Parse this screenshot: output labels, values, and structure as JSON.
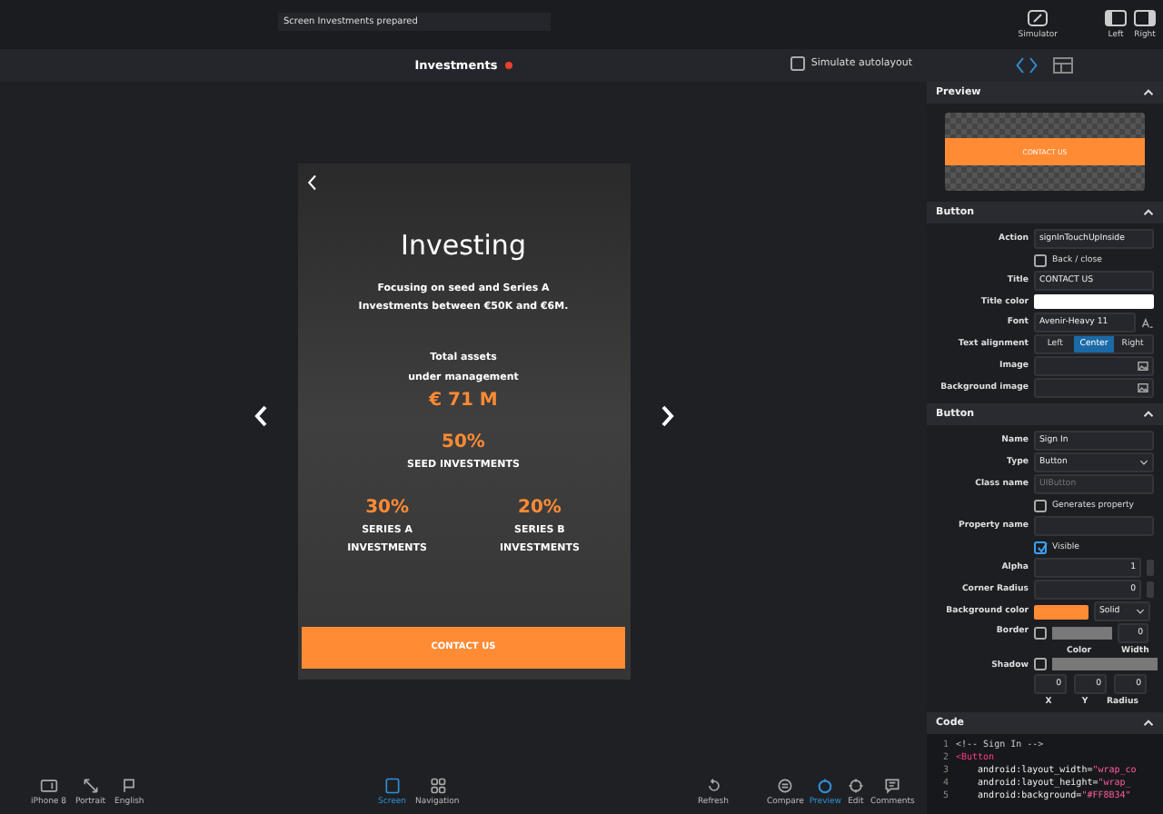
{
  "toolbar": {
    "status": "Screen Investments prepared",
    "buttons": [
      {
        "label": "Simulator"
      },
      {
        "label": "Left"
      },
      {
        "label": "Right"
      }
    ]
  },
  "canvas_header": {
    "title": "Investments",
    "unsaved": true,
    "simulate_autolayout": {
      "label": "Simulate autolayout",
      "checked": false
    }
  },
  "phone": {
    "heading": "Investing",
    "description": "Focusing on seed and Series A\nInvestments between €50K and €6M.",
    "assets_label": "Total assets\nunder management",
    "assets_value": "€ 71 M",
    "stats": [
      {
        "value": "50%",
        "label": "SEED INVESTMENTS"
      },
      {
        "value": "30%",
        "label": "SERIES A\nINVESTMENTS"
      },
      {
        "value": "20%",
        "label": "SERIES B\nINVESTMENTS"
      }
    ],
    "button": "CONTACT US"
  },
  "panel": {
    "tabs": [
      {
        "selected": true
      },
      {
        "selected": false
      }
    ],
    "preview": {
      "title": "Preview",
      "button": "CONTACT US"
    },
    "sections": [
      {
        "title": "Button",
        "rows": [
          {
            "kind": "text",
            "label": "Action",
            "value": "signInTouchUpInside"
          },
          {
            "kind": "checkbox",
            "label": "Back / close",
            "checked": false
          },
          {
            "kind": "text",
            "label": "Title",
            "value": "CONTACT US"
          },
          {
            "kind": "color",
            "label": "Title color",
            "color": "#ffffff"
          },
          {
            "kind": "font",
            "label": "Font",
            "value": "Avenir-Heavy 11"
          },
          {
            "kind": "segmented",
            "label": "Text alignment",
            "options": [
              {
                "label": "Left",
                "selected": false
              },
              {
                "label": "Center",
                "selected": true
              },
              {
                "label": "Right",
                "selected": false
              }
            ]
          },
          {
            "kind": "image",
            "label": "Image"
          },
          {
            "kind": "image",
            "label": "Background image"
          }
        ]
      },
      {
        "title": "Button",
        "rows": [
          {
            "kind": "text",
            "label": "Name",
            "value": "Sign In"
          },
          {
            "kind": "select",
            "label": "Type",
            "value": "Button"
          },
          {
            "kind": "text",
            "label": "Class name",
            "placeholder": "UIButton"
          },
          {
            "kind": "checkbox",
            "label": "Generates property",
            "checked": false
          },
          {
            "kind": "text",
            "label": "Property name"
          },
          {
            "kind": "checkbox",
            "label": "Visible",
            "checked": true
          },
          {
            "kind": "stepper",
            "label": "Alpha",
            "value": "1"
          },
          {
            "kind": "stepper",
            "label": "Corner Radius",
            "value": "0"
          },
          {
            "kind": "colorselect",
            "label": "Background color",
            "color": "#ff8b34",
            "value": "Solid"
          },
          {
            "kind": "border",
            "label": "Border",
            "checked": false,
            "value": "0",
            "sublabels": [
              "Color",
              "Width"
            ]
          },
          {
            "kind": "shadow",
            "label": "Shadow",
            "checked": false,
            "values": [
              "0",
              "0",
              "0"
            ],
            "sublabels": [
              "X",
              "Y",
              "Radius"
            ]
          }
        ]
      }
    ],
    "code": {
      "title": "Code",
      "lines": [
        {
          "number": "1",
          "text": "<!-- Sign In -->",
          "kind": "comment"
        },
        {
          "number": "2",
          "text": "<Button",
          "kind": "tag"
        },
        {
          "number": "3",
          "attr": "android:layout_width=",
          "value": "\"wrap_co",
          "kind": "attr"
        },
        {
          "number": "4",
          "attr": "android:layout_height=",
          "value": "\"wrap_",
          "kind": "attr"
        },
        {
          "number": "5",
          "attr": "android:background=",
          "value": "\"#FF8B34\"",
          "kind": "attr"
        }
      ]
    }
  },
  "bottom_bar": {
    "left": [
      {
        "label": "iPhone 8"
      },
      {
        "label": "Portrait"
      },
      {
        "label": "English"
      }
    ],
    "center": [
      {
        "label": "Screen",
        "selected": true
      },
      {
        "label": "Navigation",
        "selected": false
      }
    ],
    "right": [
      {
        "label": "Refresh",
        "selected": false
      },
      {
        "label": "Compare",
        "selected": false
      },
      {
        "label": "Preview",
        "selected": true
      },
      {
        "label": "Edit",
        "selected": false
      },
      {
        "label": "Comments",
        "selected": false
      }
    ]
  }
}
